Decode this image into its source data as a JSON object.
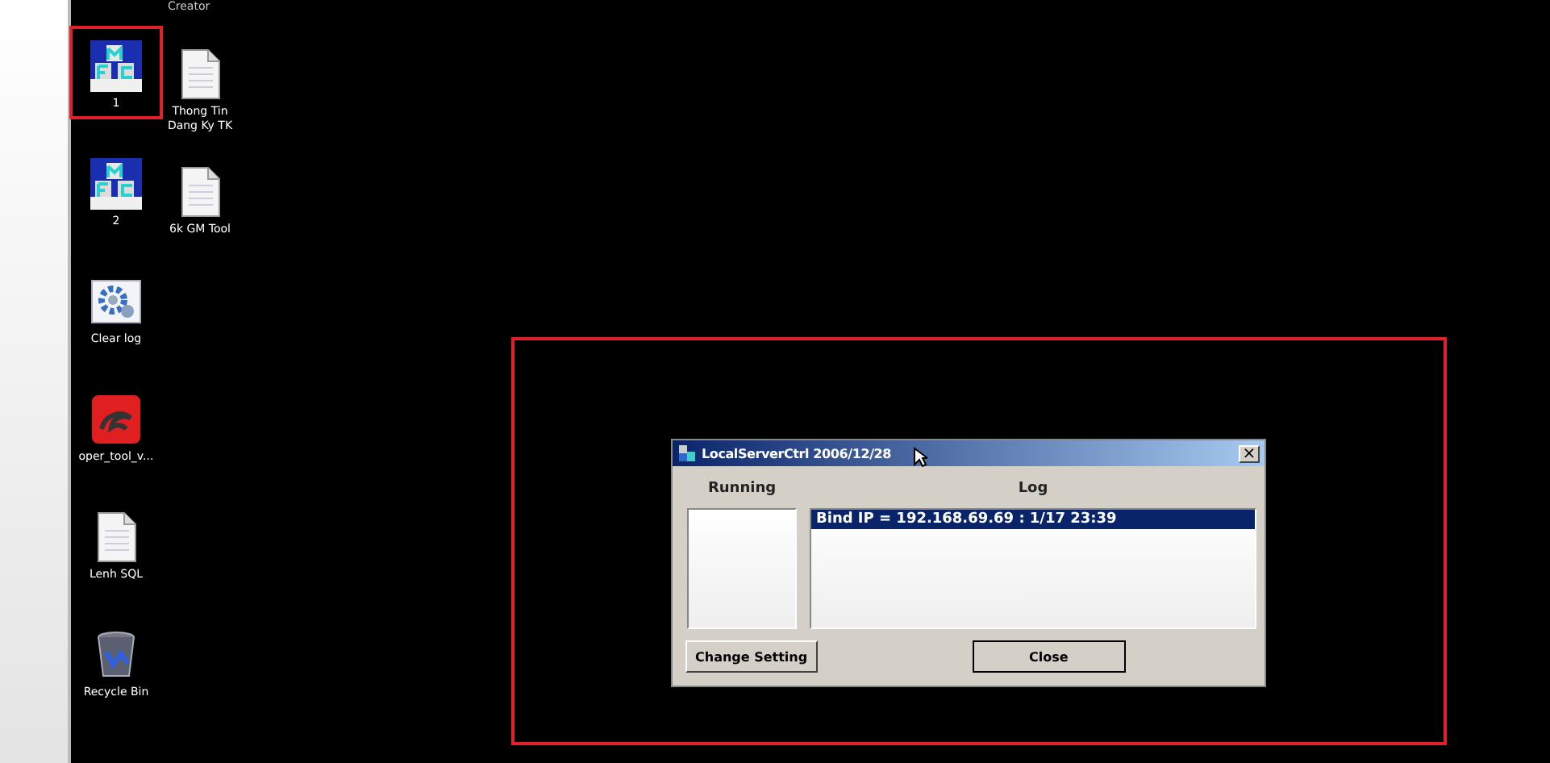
{
  "desktop": {
    "top_label": "Creator",
    "column_1": [
      {
        "label": "1",
        "kind": "mfc",
        "highlighted": true
      },
      {
        "label": "2",
        "kind": "mfc",
        "highlighted": false
      },
      {
        "label": "Clear log",
        "kind": "gear",
        "highlighted": false
      },
      {
        "label": "oper_tool_v...",
        "kind": "redapp",
        "highlighted": false
      },
      {
        "label": "Lenh SQL",
        "kind": "doc",
        "highlighted": false
      },
      {
        "label": "Recycle Bin",
        "kind": "bin",
        "highlighted": false
      }
    ],
    "column_2": [
      {
        "label": "Thong Tin Dang Ky TK",
        "kind": "doc",
        "highlighted": false
      },
      {
        "label": "6k GM Tool",
        "kind": "doc",
        "highlighted": false
      }
    ]
  },
  "dialog": {
    "title": "LocalServerCtrl 2006/12/28",
    "close": "×",
    "highlighted": true,
    "running_label": "Running",
    "log_label": "Log",
    "log": [
      {
        "text": "Bind IP = 192.168.69.69 : 1/17 23:39",
        "selected": true
      }
    ],
    "buttons": [
      "Change Setting",
      "Close"
    ]
  }
}
